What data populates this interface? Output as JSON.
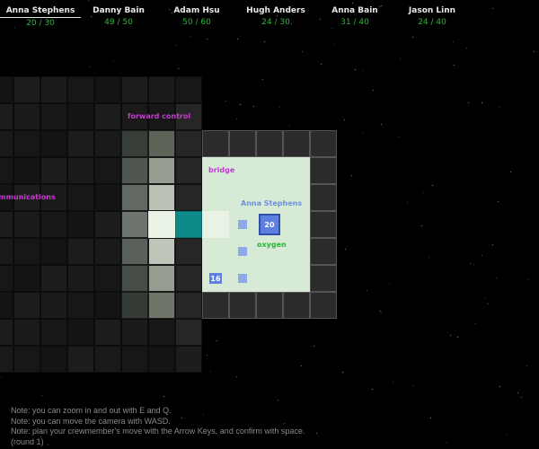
{
  "crew": [
    {
      "name": "Anna Stephens",
      "hp": "20 / 30",
      "selected": true
    },
    {
      "name": "Danny Bain",
      "hp": "49 / 50",
      "selected": false
    },
    {
      "name": "Adam Hsu",
      "hp": "50 / 60",
      "selected": false
    },
    {
      "name": "Hugh Anders",
      "hp": "24 / 30",
      "selected": false
    },
    {
      "name": "Anna Bain",
      "hp": "31 / 40",
      "selected": false
    },
    {
      "name": "Jason Linn",
      "hp": "24 / 40",
      "selected": false
    }
  ],
  "rooms": {
    "forward_control": "forward control",
    "communications": "communications",
    "bridge": "bridge",
    "oxygen": "oxygen"
  },
  "map": {
    "crew_label": "Anna Stephens",
    "unit_main_value": "20",
    "unit_small_value": "16"
  },
  "notes": [
    "Note: you can zoom in and out with E and Q.",
    "Note: you can move the camera with WASD.",
    "Note: plan your crewmember's move with the Arrow Keys, and confirm with space.",
    "(round 1)"
  ],
  "colors": {
    "health": "#2fb33a",
    "room_label": "#c43bd0",
    "crew_unit": "#5c7fe0",
    "door": "#0f8a8a"
  }
}
